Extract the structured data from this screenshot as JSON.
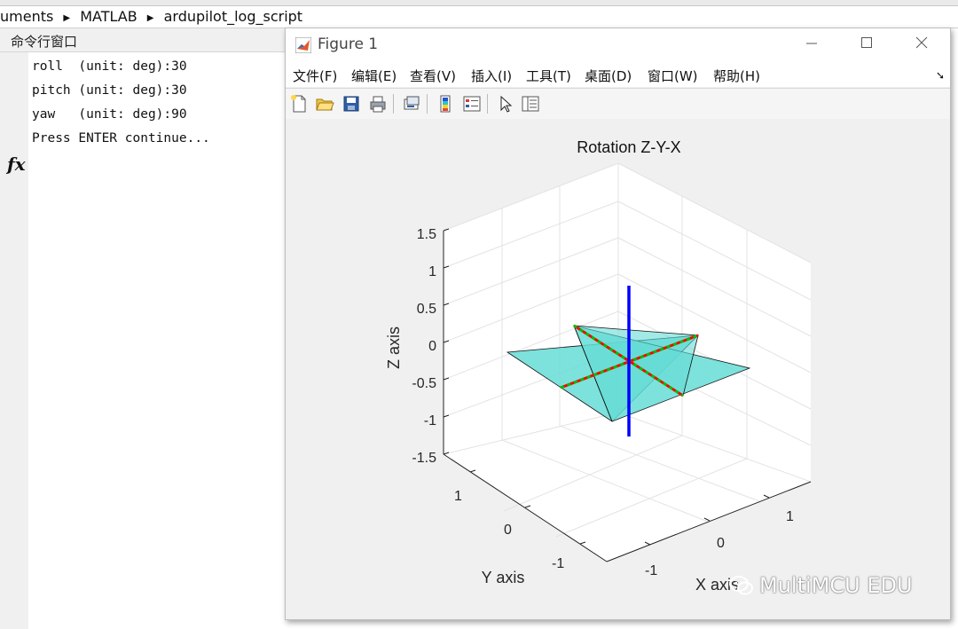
{
  "breadcrumb": {
    "items": [
      "uments",
      "MATLAB",
      "ardupilot_log_script"
    ]
  },
  "command_window": {
    "title": "命令行窗口",
    "lines": [
      "roll  (unit: deg):30",
      "pitch (unit: deg):30",
      "yaw   (unit: deg):90",
      "Press ENTER continue..."
    ],
    "prompt_icon": "fx"
  },
  "figure": {
    "window_title": "Figure 1",
    "menus": [
      "文件(F)",
      "编辑(E)",
      "查看(V)",
      "插入(I)",
      "工具(T)",
      "桌面(D)",
      "窗口(W)",
      "帮助(H)"
    ],
    "toolbar_icons": [
      "new-figure-icon",
      "open-file-icon",
      "save-icon",
      "print-icon",
      "link-plot-icon",
      "colorbar-icon",
      "legend-icon",
      "edit-plot-icon",
      "property-inspector-icon"
    ],
    "window_controls": [
      "minimize-icon",
      "maximize-icon",
      "close-icon"
    ]
  },
  "chart_data": {
    "type": "3d-line",
    "title": "Rotation Z-Y-X",
    "xlabel": "X axis",
    "ylabel": "Y axis",
    "zlabel": "Z axis",
    "xlim": [
      -1.5,
      1.5
    ],
    "ylim": [
      -1.5,
      1.5
    ],
    "zlim": [
      -1.5,
      1.5
    ],
    "z_ticks": [
      "1.5",
      "1",
      "0.5",
      "0",
      "-0.5",
      "-1",
      "-1.5"
    ],
    "y_ticks": [
      "1",
      "0",
      "-1"
    ],
    "x_ticks": [
      "1",
      "0",
      "-1"
    ],
    "grid": true,
    "colors": {
      "x_axis_line": "#ff0000",
      "y_axis_line": "#00c000",
      "z_axis_line": "#0000ff",
      "surface": "#66dcd6"
    }
  },
  "watermark": {
    "text": "MultiMCU EDU"
  }
}
